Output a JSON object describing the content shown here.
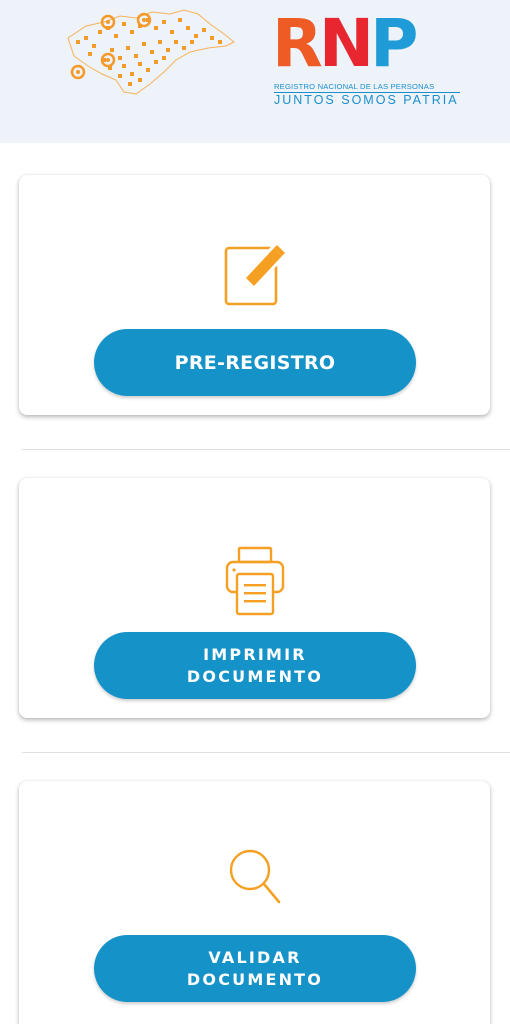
{
  "header": {
    "logo": {
      "letters": [
        "R",
        "N",
        "P"
      ],
      "subtitle": "REGISTRO NACIONAL DE LAS PERSONAS",
      "tagline": "JUNTOS SOMOS PATRIA"
    },
    "map_icon": "honduras-qr-map-icon"
  },
  "cards": [
    {
      "icon": "edit-icon",
      "button_lines": [
        "PRE-REGISTRO"
      ]
    },
    {
      "icon": "printer-icon",
      "button_lines": [
        "IMPRIMIR",
        "DOCUMENTO"
      ]
    },
    {
      "icon": "magnifier-icon",
      "button_lines": [
        "VALIDAR",
        "DOCUMENTO"
      ]
    }
  ],
  "colors": {
    "accent_orange": "#f5a023",
    "button_blue": "#1593c9",
    "header_bg": "#eef2f9"
  }
}
